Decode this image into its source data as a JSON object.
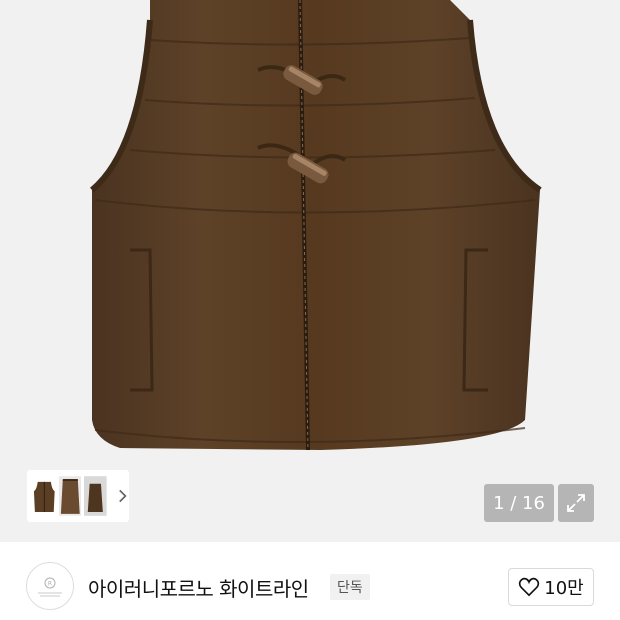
{
  "gallery": {
    "counter": "1 / 16",
    "image_alt": "brown padded toggle vest",
    "colors": {
      "vest": "#5a3f25",
      "background": "#f1f1f1"
    }
  },
  "thumbnails": {
    "icons": [
      "vest-front-thumb-icon",
      "vest-back-thumb-icon",
      "vest-side-thumb-icon"
    ],
    "next_icon": "chevron-right-icon"
  },
  "expand": {
    "icon": "expand-arrows-icon"
  },
  "brand": {
    "name": "아이러니포르노 화이트라인",
    "badge": "단독",
    "logo_icon": "brand-logo-icon"
  },
  "like": {
    "count": "10만",
    "icon": "heart-outline-icon"
  }
}
